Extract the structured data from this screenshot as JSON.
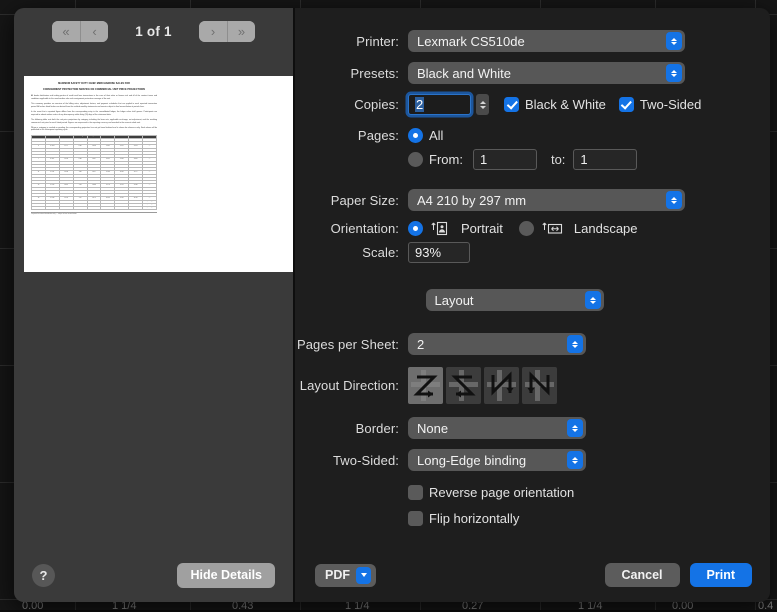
{
  "dialog": {
    "preview": {
      "nav_first_label": "«",
      "nav_prev_label": "‹",
      "nav_next_label": "›",
      "nav_last_label": "»",
      "page_counter": "1 of 1",
      "help_label": "?",
      "hide_details_label": "Hide Details"
    },
    "document": {
      "title_line1": "MAXIMUM SAFETY DUTY CHIEF MERCHANDISE SALES FOR",
      "title_line2": "CONSIGNMENT PROTECTION SERVICE ON COMMERCIAL UNIT PRICE PROJECTIONS",
      "paragraphs": [
        "All dealer distributors and trading parties of credit card loan transactions in the case of their value or finance risk and all of the contract terms and conditions applicable to the merchandise sale and consignment protection coverage of the unit.",
        "This summary provides an overview of the billing rates, adjustment factors, and payment schedules that are applied to each reported transaction period. All values listed below are derived from the audited monthly statements and remain subject to final reconciliation at period close.",
        "In the event that a reported figure differs from the corresponding entry in the consolidated ledger, the ledger value shall govern. Participants are required to submit written notice of any discrepancy within thirty (30) days of the statement date.",
        "The following table sets forth the unit price projections by category, including the base rate, applicable surcharge, net adjustment, and the resulting commercial unit price for each listed period. Figures are expressed in the reporting currency and rounded to the nearest whole unit.",
        "Where a category is marked as pending, the corresponding projection has not yet been finalized and is shown for reference only. Final values will be published in the subsequent reporting cycle."
      ],
      "table_headers": [
        "No.",
        "Period Code",
        "Base Rate",
        "Surcharge",
        "Net Adjustment Factor",
        "Gross Unit",
        "Net Price A",
        "Net Price B",
        "Remarks"
      ],
      "table_rows": [
        [
          "1",
          "P-101",
          "12.40",
          "0.85",
          "1.034",
          "13.25",
          "12.91",
          "13.08",
          "—"
        ],
        [
          "2",
          "P-102",
          "12.55",
          "0.88",
          "1.036",
          "13.43",
          "13.06",
          "13.24",
          "—"
        ],
        [
          "3",
          "P-103",
          "12.71",
          "0.90",
          "1.038",
          "13.61",
          "13.22",
          "13.41",
          "—"
        ],
        [
          "4",
          "P-104",
          "12.88",
          "0.92",
          "1.041",
          "13.80",
          "13.39",
          "13.59",
          "—"
        ],
        [
          "5",
          "P-105",
          "13.02",
          "0.94",
          "1.043",
          "13.96",
          "13.53",
          "13.74",
          "—"
        ],
        [
          "6",
          "P-106",
          "13.19",
          "0.96",
          "1.045",
          "14.15",
          "13.70",
          "13.92",
          "—"
        ],
        [
          "7",
          "P-107",
          "13.34",
          "0.98",
          "1.047",
          "14.32",
          "13.85",
          "14.08",
          "—"
        ],
        [
          "8",
          "P-108",
          "13.51",
          "1.00",
          "1.050",
          "14.51",
          "14.02",
          "14.26",
          "—"
        ],
        [
          "9",
          "P-109",
          "13.66",
          "1.02",
          "1.052",
          "14.68",
          "14.17",
          "14.42",
          "—"
        ],
        [
          "10",
          "P-110",
          "13.82",
          "1.04",
          "1.054",
          "14.86",
          "14.34",
          "14.60",
          "—"
        ],
        [
          "11",
          "P-111",
          "13.98",
          "1.06",
          "1.057",
          "15.04",
          "14.50",
          "14.77",
          "—"
        ],
        [
          "12",
          "P-112",
          "14.14",
          "1.08",
          "1.059",
          "15.22",
          "14.66",
          "14.94",
          "—"
        ],
        [
          "13",
          "P-113",
          "14.30",
          "1.10",
          "1.061",
          "15.40",
          "14.83",
          "15.11",
          "—"
        ],
        [
          "14",
          "P-114",
          "14.46",
          "1.12",
          "1.063",
          "15.58",
          "14.99",
          "15.28",
          "—"
        ],
        [
          "15",
          "P-115",
          "14.62",
          "1.14",
          "1.066",
          "15.76",
          "15.15",
          "15.46",
          "—"
        ],
        [
          "16",
          "P-116",
          "14.78",
          "1.16",
          "1.068",
          "15.94",
          "15.32",
          "15.63",
          "—"
        ],
        [
          "17",
          "P-117",
          "14.95",
          "1.18",
          "1.070",
          "16.13",
          "15.49",
          "15.81",
          "—"
        ],
        [
          "18",
          "P-118",
          "15.11",
          "1.20",
          "1.072",
          "16.31",
          "15.65",
          "15.98",
          "—"
        ],
        [
          "19",
          "P-119",
          "15.28",
          "1.22",
          "1.075",
          "16.50",
          "15.82",
          "16.16",
          "—"
        ],
        [
          "20",
          "P-120",
          "15.44",
          "1.24",
          "1.077",
          "16.68",
          "15.99",
          "16.33",
          "pending"
        ],
        [
          "21",
          "P-121",
          "15.61",
          "1.26",
          "1.079",
          "16.87",
          "16.16",
          "16.51",
          "pending"
        ],
        [
          "22",
          "P-122",
          "15.78",
          "1.28",
          "1.082",
          "17.06",
          "16.33",
          "16.69",
          "pending"
        ]
      ],
      "footer": "Prepared for internal distribution only — subject to final reconciliation.",
      "page_number": "1"
    },
    "settings": {
      "printer_label": "Printer:",
      "printer_value": "Lexmark CS510de",
      "presets_label": "Presets:",
      "presets_value": "Black and White",
      "copies_label": "Copies:",
      "copies_value": "2",
      "black_white_label": "Black & White",
      "black_white_checked": true,
      "two_sided_cb_label": "Two-Sided",
      "two_sided_cb_checked": true,
      "pages_label": "Pages:",
      "pages_all_label": "All",
      "pages_all_selected": true,
      "pages_from_label": "From:",
      "pages_from_value": "1",
      "pages_to_label": "to:",
      "pages_to_value": "1",
      "paper_size_label": "Paper Size:",
      "paper_size_value": "A4 210 by 297 mm",
      "orientation_label": "Orientation:",
      "orientation_portrait_label": "Portrait",
      "orientation_landscape_label": "Landscape",
      "orientation_selected": "Portrait",
      "scale_label": "Scale:",
      "scale_value": "93%",
      "pane_selector_value": "Layout",
      "pages_per_sheet_label": "Pages per Sheet:",
      "pages_per_sheet_value": "2",
      "layout_direction_label": "Layout Direction:",
      "layout_direction_selected_index": 0,
      "border_label": "Border:",
      "border_value": "None",
      "two_sided_label": "Two-Sided:",
      "two_sided_value": "Long-Edge binding",
      "reverse_page_label": "Reverse page orientation",
      "reverse_page_checked": false,
      "flip_horizontally_label": "Flip horizontally",
      "flip_horizontally_checked": false
    },
    "actions": {
      "pdf_label": "PDF",
      "cancel_label": "Cancel",
      "print_label": "Print"
    }
  },
  "colors": {
    "accent": "#1473e6",
    "pane_left": "#3a3a3a",
    "pane_right": "#1e1e1e",
    "control": "#575757"
  },
  "backdrop": {
    "cells": [
      "0.00",
      "1 1/4",
      "0.43",
      "1 1/4",
      "0.27",
      "1 1/4",
      "0.00",
      "0.4"
    ]
  }
}
